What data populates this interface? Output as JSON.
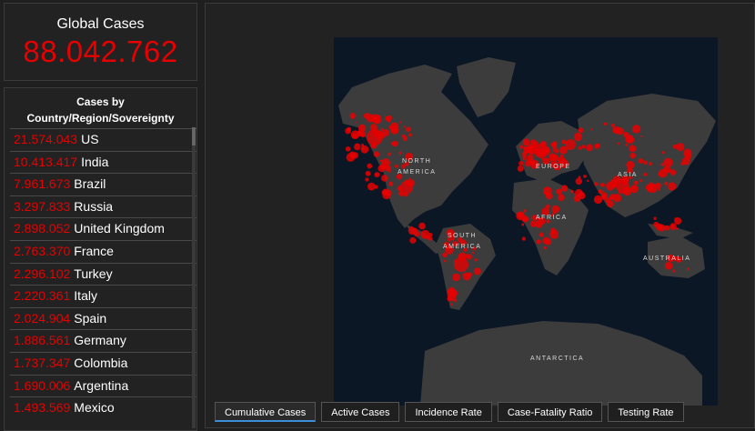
{
  "global": {
    "title": "Global Cases",
    "value": "88.042.762"
  },
  "list": {
    "heading_line1": "Cases by",
    "heading_line2": "Country/Region/Sovereignty",
    "rows": [
      {
        "value": "21.574.043",
        "name": "US"
      },
      {
        "value": "10.413.417",
        "name": "India"
      },
      {
        "value": "7.961.673",
        "name": "Brazil"
      },
      {
        "value": "3.297.833",
        "name": "Russia"
      },
      {
        "value": "2.898.052",
        "name": "United Kingdom"
      },
      {
        "value": "2.763.370",
        "name": "France"
      },
      {
        "value": "2.296.102",
        "name": "Turkey"
      },
      {
        "value": "2.220.361",
        "name": "Italy"
      },
      {
        "value": "2.024.904",
        "name": "Spain"
      },
      {
        "value": "1.886.561",
        "name": "Germany"
      },
      {
        "value": "1.737.347",
        "name": "Colombia"
      },
      {
        "value": "1.690.006",
        "name": "Argentina"
      },
      {
        "value": "1.493.569",
        "name": "Mexico"
      }
    ]
  },
  "map": {
    "labels": {
      "north_america_1": "NORTH",
      "north_america_2": "AMERICA",
      "south_america_1": "SOUTH",
      "south_america_2": "AMERICA",
      "europe": "EUROPE",
      "asia": "ASIA",
      "africa": "AFRICA",
      "australia": "AUSTRALIA",
      "antarctica": "ANTARCTICA"
    }
  },
  "tabs": [
    {
      "label": "Cumulative Cases",
      "active": true
    },
    {
      "label": "Active Cases",
      "active": false
    },
    {
      "label": "Incidence Rate",
      "active": false
    },
    {
      "label": "Case-Fatality Ratio",
      "active": false
    },
    {
      "label": "Testing Rate",
      "active": false
    }
  ],
  "colors": {
    "accent_red": "#e60000",
    "ocean": "#0b1725",
    "land": "#3c3c3c",
    "tab_active": "#3a8fd8"
  }
}
